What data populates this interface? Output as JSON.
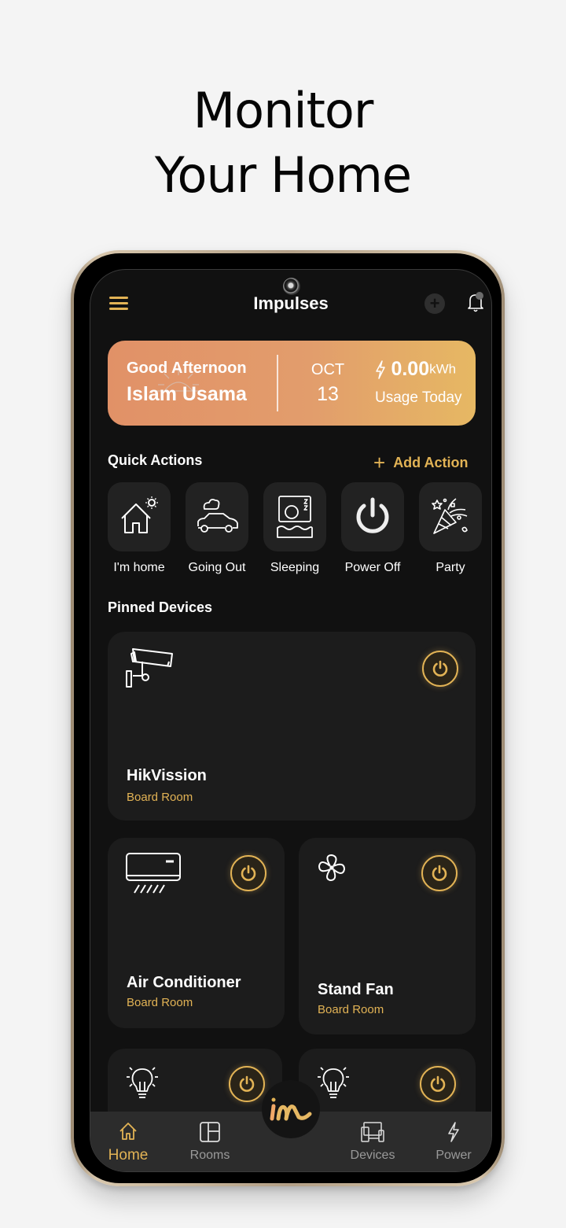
{
  "headline": {
    "line1": "Monitor",
    "line2": "Your Home"
  },
  "app": {
    "title": "Impulses",
    "menu_icon": "hamburger-menu-icon",
    "add_icon": "plus-circle-icon",
    "notifications_icon": "bell-icon"
  },
  "banner": {
    "greeting": "Good Afternoon",
    "user_name": "Islam Usama",
    "month": "OCT",
    "day": "13",
    "usage_value": "0.00",
    "usage_unit": "kWh",
    "usage_label": "Usage Today"
  },
  "quick_actions": {
    "title": "Quick Actions",
    "add_label": "Add Action",
    "items": [
      {
        "label": "I'm home",
        "icon": "house-sun-icon"
      },
      {
        "label": "Going Out",
        "icon": "car-cloud-icon"
      },
      {
        "label": "Sleeping",
        "icon": "sleeping-person-icon"
      },
      {
        "label": "Power Off",
        "icon": "power-icon"
      },
      {
        "label": "Party",
        "icon": "party-popper-icon"
      }
    ]
  },
  "pinned_devices": {
    "title": "Pinned Devices",
    "items": [
      {
        "name": "HikVission",
        "room": "Board Room",
        "icon": "security-camera-icon",
        "on": true
      },
      {
        "name": "Air Conditioner",
        "room": "Board Room",
        "icon": "air-conditioner-icon",
        "on": true
      },
      {
        "name": "Stand Fan",
        "room": "Board Room",
        "icon": "fan-icon",
        "on": true
      },
      {
        "name": "",
        "room": "",
        "icon": "light-bulb-icon",
        "on": true
      },
      {
        "name": "",
        "room": "",
        "icon": "light-bulb-icon",
        "on": true
      }
    ]
  },
  "bottom_nav": {
    "items": [
      {
        "label": "Home",
        "icon": "home-icon",
        "active": true
      },
      {
        "label": "Rooms",
        "icon": "rooms-grid-icon",
        "active": false
      },
      {
        "label": "Devices",
        "icon": "devices-icon",
        "active": false
      },
      {
        "label": "Power",
        "icon": "lightning-icon",
        "active": false
      }
    ],
    "center_logo": "im"
  },
  "colors": {
    "accent": "#e2b355",
    "background": "#111111",
    "card": "#1c1c1c",
    "banner_start": "#e19167",
    "banner_end": "#e6b863",
    "nav_bg": "#2c2c2c"
  }
}
